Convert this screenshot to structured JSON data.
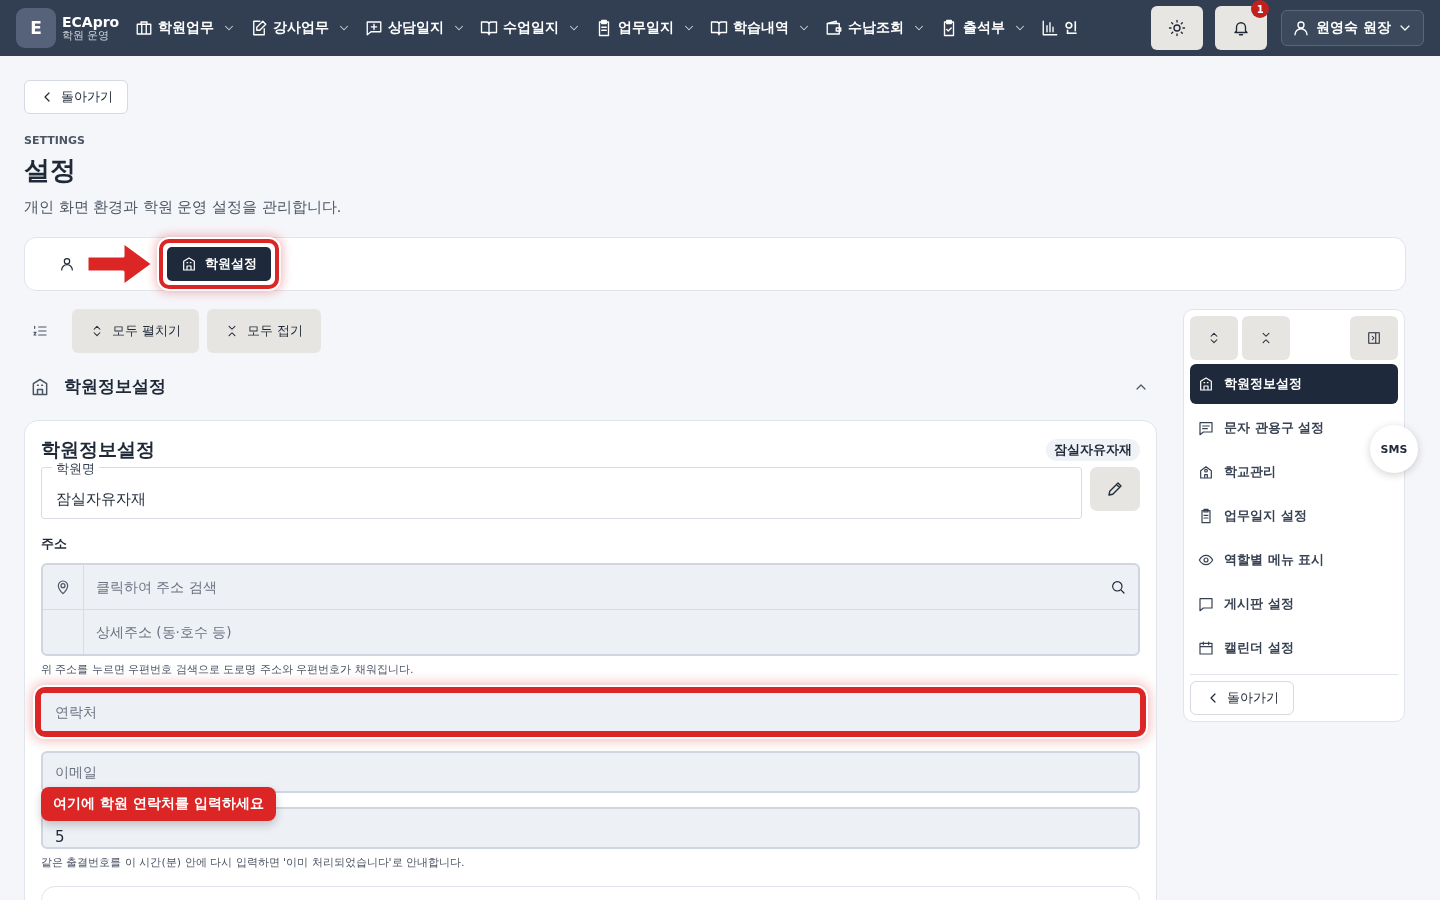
{
  "topbar": {
    "logo": {
      "letter": "E",
      "title": "ECApro",
      "subtitle": "학원 운영"
    },
    "nav": [
      {
        "label": "학원업무"
      },
      {
        "label": "강사업무"
      },
      {
        "label": "상담일지"
      },
      {
        "label": "수업일지"
      },
      {
        "label": "업무일지"
      },
      {
        "label": "학습내역"
      },
      {
        "label": "수납조회"
      },
      {
        "label": "출석부"
      },
      {
        "label": "인"
      }
    ],
    "notifications": {
      "count": "1"
    },
    "user": {
      "label": "원영숙 원장"
    }
  },
  "back_button": {
    "label": "돌아가기"
  },
  "header": {
    "eyebrow": "SETTINGS",
    "title": "설정",
    "description": "개인 화면 환경과 학원 운영 설정을 관리합니다."
  },
  "tabs": [
    {
      "selected": false
    },
    {
      "label": "학원설정",
      "selected": true,
      "highlighted": true
    }
  ],
  "toolbar": {
    "expand_all": "모두 펼치기",
    "collapse_all": "모두 접기"
  },
  "section": {
    "title": "학원정보설정",
    "expanded": true
  },
  "card": {
    "title": "학원정보설정",
    "badge": "잠실자유자재",
    "name_field": {
      "label": "학원명",
      "value": "잠실자유자재"
    },
    "address": {
      "label": "주소",
      "search_placeholder": "클릭하여 주소 검색",
      "detail_placeholder": "상세주소 (동·호수 등)",
      "hint": "위 주소를 누르면 우편번호 검색으로 도로명 주소와 우편번호가 채워집니다."
    },
    "phone_field": {
      "placeholder": "연락처",
      "highlighted": true,
      "tooltip": "여기에 학원 연락처를 입력하세요"
    },
    "email_field": {
      "placeholder": "이메일",
      "highlighted": false
    },
    "interval_field": {
      "value": "5",
      "hint": "같은 출결번호를 이 시간(분) 안에 다시 입력하면 '이미 처리되었습니다'로 안내합니다."
    }
  },
  "side_nav": {
    "items": [
      {
        "label": "학원정보설정",
        "selected": true
      },
      {
        "label": "문자 관용구 설정",
        "selected": false
      },
      {
        "label": "학교관리",
        "selected": false
      },
      {
        "label": "업무일지 설정",
        "selected": false
      },
      {
        "label": "역할별 메뉴 표시",
        "selected": false
      },
      {
        "label": "게시판 설정",
        "selected": false
      },
      {
        "label": "캘린더 설정",
        "selected": false
      }
    ],
    "back_button": {
      "label": "돌아가기"
    }
  },
  "floating_badge": {
    "label": "SMS"
  }
}
